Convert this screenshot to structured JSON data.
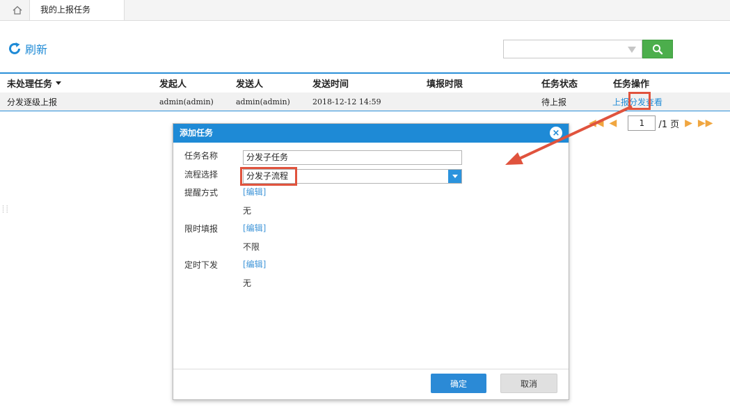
{
  "tabs": {
    "active": "我的上报任务"
  },
  "toolbar": {
    "refresh_label": "刷新",
    "search_placeholder": ""
  },
  "table": {
    "headers": [
      "未处理任务",
      "发起人",
      "发送人",
      "发送时间",
      "填报时限",
      "任务状态",
      "任务操作"
    ],
    "rows": [
      {
        "task": "分发逐级上报",
        "initiator": "admin(admin)",
        "sender": "admin(admin)",
        "send_time": "2018-12-12 14:59",
        "deadline": "",
        "status": "待上报",
        "actions": [
          "上报",
          "分发",
          "查看"
        ]
      }
    ]
  },
  "pager": {
    "current": "1",
    "total": "/1 页"
  },
  "dialog": {
    "title": "添加任务",
    "fields": {
      "name_label": "任务名称",
      "name_value": "分发子任务",
      "flow_label": "流程选择",
      "flow_value": "分发子流程",
      "remind_label": "提醒方式",
      "remind_value": "无",
      "limit_label": "限时填报",
      "limit_value": "不限",
      "timed_label": "定时下发",
      "timed_value": "无",
      "edit_link": "[编辑]"
    },
    "ok_label": "确定",
    "cancel_label": "取消"
  },
  "colors": {
    "accent": "#1e8ad6",
    "highlight": "#e0533d",
    "search_button": "#4cae4c"
  }
}
